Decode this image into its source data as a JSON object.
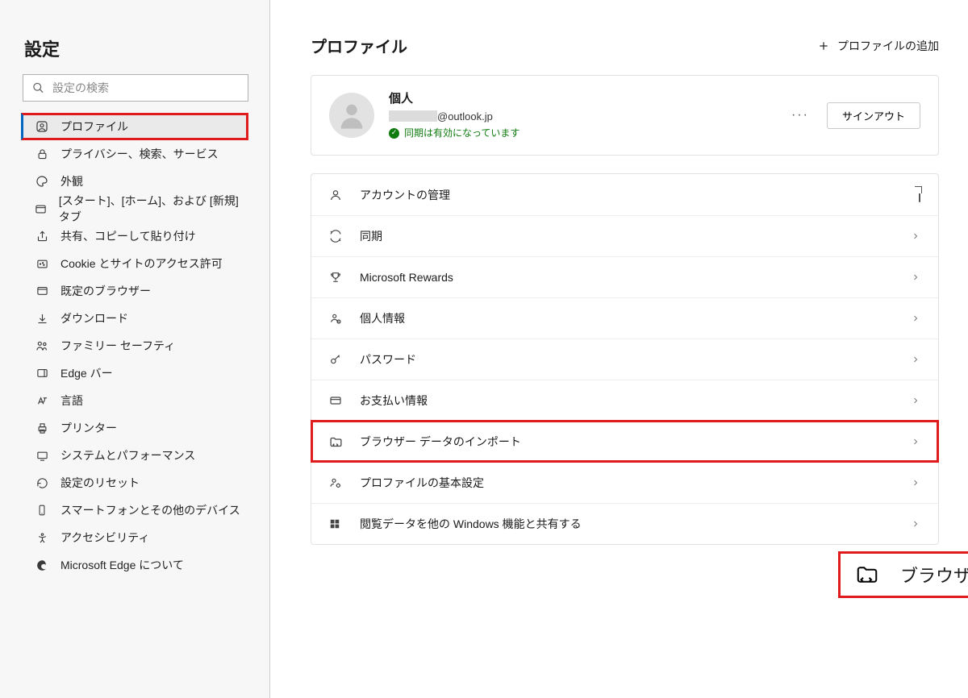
{
  "sidebar": {
    "title": "設定",
    "search_placeholder": "設定の検索",
    "items": [
      {
        "label": "プロファイル",
        "active": true
      },
      {
        "label": "プライバシー、検索、サービス"
      },
      {
        "label": "外観"
      },
      {
        "label": "[スタート]、[ホーム]、および [新規] タブ"
      },
      {
        "label": "共有、コピーして貼り付け"
      },
      {
        "label": "Cookie とサイトのアクセス許可"
      },
      {
        "label": "既定のブラウザー"
      },
      {
        "label": "ダウンロード"
      },
      {
        "label": "ファミリー セーフティ"
      },
      {
        "label": "Edge バー"
      },
      {
        "label": "言語"
      },
      {
        "label": "プリンター"
      },
      {
        "label": "システムとパフォーマンス"
      },
      {
        "label": "設定のリセット"
      },
      {
        "label": "スマートフォンとその他のデバイス"
      },
      {
        "label": "アクセシビリティ"
      },
      {
        "label": "Microsoft Edge について"
      }
    ]
  },
  "main": {
    "title": "プロファイル",
    "add_profile": "プロファイルの追加",
    "profile": {
      "name": "個人",
      "email_suffix": "@outlook.jp",
      "sync_status": "同期は有効になっています",
      "signout": "サインアウト"
    },
    "rows": [
      {
        "label": "アカウントの管理"
      },
      {
        "label": "同期"
      },
      {
        "label": "Microsoft Rewards"
      },
      {
        "label": "個人情報"
      },
      {
        "label": "パスワード"
      },
      {
        "label": "お支払い情報"
      },
      {
        "label": "ブラウザー データのインポート",
        "highlight": true
      },
      {
        "label": "プロファイルの基本設定"
      },
      {
        "label": "閲覧データを他の Windows 機能と共有する"
      }
    ]
  },
  "callout": {
    "label": "ブラウザー データのインポート"
  }
}
